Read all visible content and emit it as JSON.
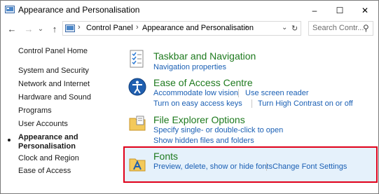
{
  "window": {
    "title": "Appearance and Personalisation",
    "minimize": "–",
    "maximize": "☐",
    "close": "✕"
  },
  "nav": {
    "back": "←",
    "forward": "→",
    "down": "⌄",
    "up": "↑",
    "refresh": "↻",
    "breadcrumbs": [
      "Control Panel",
      "Appearance and Personalisation"
    ],
    "separator": "›",
    "dropdown": "⌄",
    "search_placeholder": "Search Contr...",
    "search_glyph": "⚲"
  },
  "sidebar": {
    "home": "Control Panel Home",
    "items": [
      "System and Security",
      "Network and Internet",
      "Hardware and Sound",
      "Programs",
      "User Accounts",
      "Appearance and",
      "Personalisation",
      "Clock and Region",
      "Ease of Access"
    ]
  },
  "categories": [
    {
      "title": "Taskbar and Navigation",
      "links": [
        "Navigation properties"
      ]
    },
    {
      "title": "Ease of Access Centre",
      "links": [
        "Accommodate low vision",
        "Use screen reader",
        "Turn on easy access keys",
        "Turn High Contrast on or off"
      ]
    },
    {
      "title": "File Explorer Options",
      "links": [
        "Specify single- or double-click to open",
        "Show hidden files and folders"
      ]
    },
    {
      "title": "Fonts",
      "links": [
        "Preview, delete, show or hide fonts",
        "Change Font Settings"
      ]
    }
  ],
  "colors": {
    "category_title": "#1e7a1e",
    "link": "#1a5fb4",
    "highlight_border": "#e0001a",
    "highlight_fill": "#e5f1fb"
  }
}
